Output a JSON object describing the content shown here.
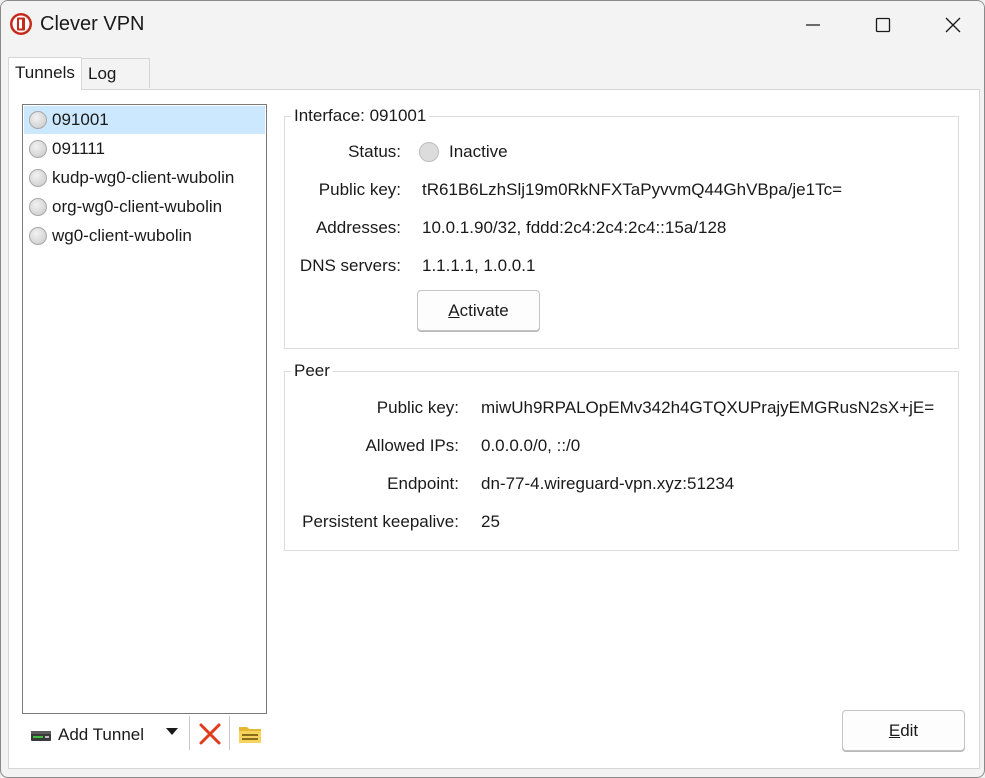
{
  "window": {
    "title": "Clever VPN"
  },
  "tabs": [
    {
      "label": "Tunnels",
      "active": true
    },
    {
      "label": "Log",
      "active": false
    }
  ],
  "tunnels": [
    {
      "name": "091001",
      "selected": true
    },
    {
      "name": "091111",
      "selected": false
    },
    {
      "name": "kudp-wg0-client-wubolin",
      "selected": false
    },
    {
      "name": "org-wg0-client-wubolin",
      "selected": false
    },
    {
      "name": "wg0-client-wubolin",
      "selected": false
    }
  ],
  "toolbar": {
    "add_label": "Add Tunnel"
  },
  "interface": {
    "title": "Interface: 091001",
    "status_label": "Status:",
    "status_value": "Inactive",
    "public_key_label": "Public key:",
    "public_key_value": "tR61B6LzhSlj19m0RkNFXTaPyvvmQ44GhVBpa/je1Tc=",
    "addresses_label": "Addresses:",
    "addresses_value": "10.0.1.90/32, fddd:2c4:2c4:2c4::15a/128",
    "dns_label": "DNS servers:",
    "dns_value": "1.1.1.1, 1.0.0.1",
    "activate_accel": "A",
    "activate_rest": "ctivate"
  },
  "peer": {
    "title": "Peer",
    "public_key_label": "Public key:",
    "public_key_value": "miwUh9RPALOpEMv342h4GTQXUPrajyEMGRusN2sX+jE=",
    "allowed_ips_label": "Allowed IPs:",
    "allowed_ips_value": "0.0.0.0/0, ::/0",
    "endpoint_label": "Endpoint:",
    "endpoint_value": "dn-77-4.wireguard-vpn.xyz:51234",
    "keepalive_label": "Persistent keepalive:",
    "keepalive_value": "25"
  },
  "edit": {
    "accel": "E",
    "rest": "dit"
  },
  "colors": {
    "selection": "#cce8ff",
    "delete": "#e03c1c",
    "accent": "#c42b1c"
  },
  "icons": [
    "app-shield-icon",
    "minimize-icon",
    "maximize-icon",
    "close-icon",
    "add-tunnel-icon",
    "dropdown-caret-icon",
    "delete-icon",
    "export-folder-icon",
    "status-dot-icon"
  ]
}
